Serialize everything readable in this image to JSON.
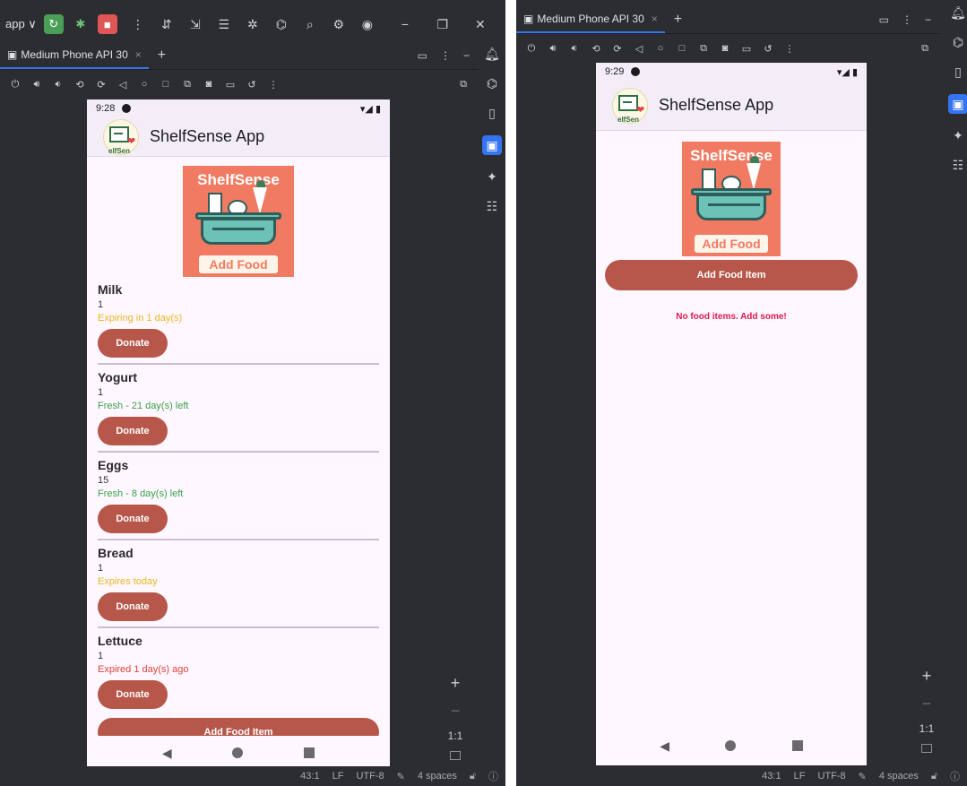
{
  "left": {
    "toolbar": {
      "app_label": "app ∨"
    },
    "tab": {
      "label": "Medium Phone API 30",
      "close": "×",
      "add": "+"
    },
    "phone": {
      "time": "9:28",
      "signal": "▾◢ ▮",
      "app_title": "ShelfSense App",
      "logo_text": "elfSen",
      "hero_title": "ShelfSense",
      "hero_button": "Add Food",
      "items": [
        {
          "name": "Milk",
          "qty": "1",
          "status": "Expiring in 1 day(s)",
          "color": "#e8b820",
          "donate": "Donate"
        },
        {
          "name": "Yogurt",
          "qty": "1",
          "status": "Fresh - 21 day(s) left",
          "color": "#3ba14a",
          "donate": "Donate"
        },
        {
          "name": "Eggs",
          "qty": "15",
          "status": "Fresh - 8 day(s) left",
          "color": "#3ba14a",
          "donate": "Donate"
        },
        {
          "name": "Bread",
          "qty": "1",
          "status": "Expires today",
          "color": "#e8b820",
          "donate": "Donate"
        },
        {
          "name": "Lettuce",
          "qty": "1",
          "status": "Expired 1 day(s) ago",
          "color": "#e0413a",
          "donate": "Donate"
        }
      ],
      "add_item": "Add Food Item"
    },
    "zoom": {
      "plus": "+",
      "minus": "−",
      "ratio": "1:1"
    },
    "status": {
      "pos": "43:1",
      "lf": "LF",
      "enc": "UTF-8",
      "indent": "4 spaces"
    }
  },
  "right": {
    "tab": {
      "label": "Medium Phone API 30",
      "close": "×",
      "add": "+"
    },
    "phone": {
      "time": "9:29",
      "signal": "▾◢ ▮",
      "app_title": "ShelfSense App",
      "logo_text": "elfSen",
      "hero_title": "ShelfSense",
      "hero_button": "Add Food",
      "add_item": "Add Food Item",
      "empty_message": "No food items. Add some!"
    },
    "zoom": {
      "plus": "+",
      "minus": "−",
      "ratio": "1:1"
    },
    "status": {
      "pos": "43:1",
      "lf": "LF",
      "enc": "UTF-8",
      "indent": "4 spaces"
    }
  }
}
